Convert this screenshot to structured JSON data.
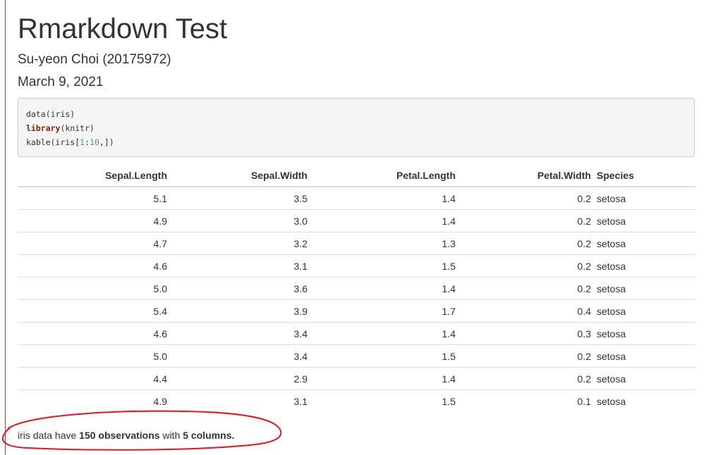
{
  "document": {
    "title": "Rmarkdown Test",
    "author": "Su-yeon Choi (20175972)",
    "date": "March 9, 2021"
  },
  "code": {
    "line1": "data(iris)",
    "line2_kw": "library",
    "line2_rest": "(knitr)",
    "line3_a": "kable(iris[",
    "line3_num1": "1",
    "line3_colon": ":",
    "line3_num2": "10",
    "line3_b": ",])"
  },
  "table": {
    "headers": [
      "Sepal.Length",
      "Sepal.Width",
      "Petal.Length",
      "Petal.Width",
      "Species"
    ],
    "rows": [
      [
        "5.1",
        "3.5",
        "1.4",
        "0.2",
        "setosa"
      ],
      [
        "4.9",
        "3.0",
        "1.4",
        "0.2",
        "setosa"
      ],
      [
        "4.7",
        "3.2",
        "1.3",
        "0.2",
        "setosa"
      ],
      [
        "4.6",
        "3.1",
        "1.5",
        "0.2",
        "setosa"
      ],
      [
        "5.0",
        "3.6",
        "1.4",
        "0.2",
        "setosa"
      ],
      [
        "5.4",
        "3.9",
        "1.7",
        "0.4",
        "setosa"
      ],
      [
        "4.6",
        "3.4",
        "1.4",
        "0.3",
        "setosa"
      ],
      [
        "5.0",
        "3.4",
        "1.5",
        "0.2",
        "setosa"
      ],
      [
        "4.4",
        "2.9",
        "1.4",
        "0.2",
        "setosa"
      ],
      [
        "4.9",
        "3.1",
        "1.5",
        "0.1",
        "setosa"
      ]
    ]
  },
  "summary": {
    "prefix": "iris data have ",
    "observations": "150 observations",
    "middle": " with ",
    "columns": "5 columns."
  },
  "annotation_color": "#e8141a"
}
